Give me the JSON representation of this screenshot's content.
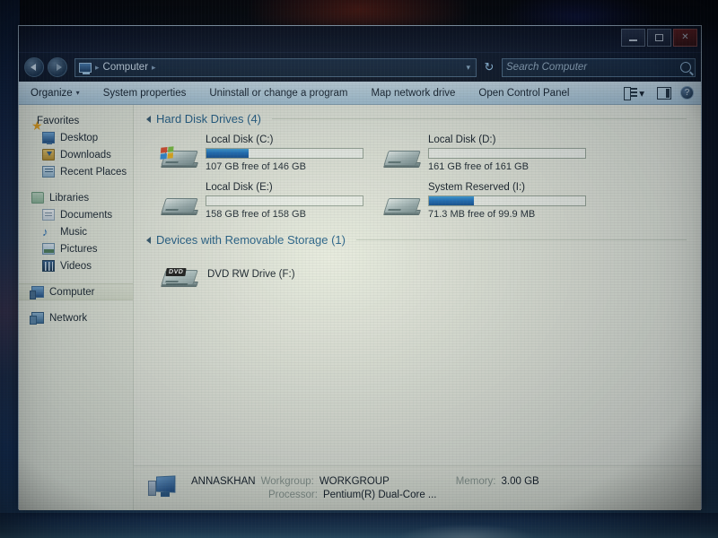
{
  "window": {
    "controls": {
      "minimize": "–",
      "maximize": "□",
      "close": "✕"
    }
  },
  "address_bar": {
    "back_icon": "back-arrow-icon",
    "forward_icon": "forward-arrow-icon",
    "computer_icon": "computer-icon",
    "breadcrumb": "Computer",
    "separator": "▸",
    "dropdown_icon": "▾",
    "refresh_icon": "↻",
    "search_placeholder": "Search Computer",
    "search_value": "",
    "search_icon": "search-icon"
  },
  "command_bar": {
    "organize": "Organize",
    "organize_caret": "▾",
    "system_properties": "System properties",
    "uninstall": "Uninstall or change a program",
    "map_drive": "Map network drive",
    "control_panel": "Open Control Panel",
    "views_caret": "▾",
    "help_glyph": "?"
  },
  "sidebar": {
    "groups": [
      {
        "header": {
          "label": "Favorites",
          "icon": "star-icon"
        },
        "items": [
          {
            "label": "Desktop",
            "icon": "desktop-icon"
          },
          {
            "label": "Downloads",
            "icon": "downloads-icon"
          },
          {
            "label": "Recent Places",
            "icon": "recent-places-icon"
          }
        ]
      },
      {
        "header": {
          "label": "Libraries",
          "icon": "libraries-icon"
        },
        "items": [
          {
            "label": "Documents",
            "icon": "documents-icon"
          },
          {
            "label": "Music",
            "icon": "music-icon"
          },
          {
            "label": "Pictures",
            "icon": "pictures-icon"
          },
          {
            "label": "Videos",
            "icon": "videos-icon"
          }
        ]
      },
      {
        "header": {
          "label": "Computer",
          "icon": "computer-icon",
          "selected": true
        },
        "items": []
      },
      {
        "header": {
          "label": "Network",
          "icon": "network-icon"
        },
        "items": []
      }
    ]
  },
  "content": {
    "groups": [
      {
        "title": "Hard Disk Drives (4)",
        "drives": [
          {
            "name": "Local Disk (C:)",
            "free_text": "107 GB free of 146 GB",
            "used_percent": 27,
            "has_windows_badge": true
          },
          {
            "name": "Local Disk (D:)",
            "free_text": "161 GB free of 161 GB",
            "used_percent": 0,
            "has_windows_badge": false
          },
          {
            "name": "Local Disk (E:)",
            "free_text": "158 GB free of 158 GB",
            "used_percent": 0,
            "has_windows_badge": false
          },
          {
            "name": "System Reserved (I:)",
            "free_text": "71.3 MB free of 99.9 MB",
            "used_percent": 29,
            "has_windows_badge": false
          }
        ]
      },
      {
        "title": "Devices with Removable Storage (1)",
        "dvd": {
          "name": "DVD RW Drive (F:)",
          "badge": "DVD"
        }
      }
    ]
  },
  "status_bar": {
    "computer_name": "ANNASKHAN",
    "workgroup_label": "Workgroup:",
    "workgroup_value": "WORKGROUP",
    "memory_label": "Memory:",
    "memory_value": "3.00 GB",
    "processor_label": "Processor:",
    "processor_value": "Pentium(R) Dual-Core ..."
  },
  "colors": {
    "accent_blue": "#1a6fc0",
    "group_heading": "#1f5d88",
    "content_bg": "#eaede2"
  }
}
